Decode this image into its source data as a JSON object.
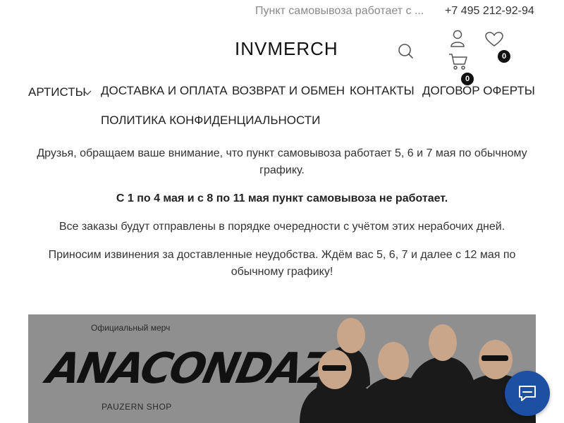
{
  "topbar": {
    "pickup_notice": "Пункт самовывоза работает с ...",
    "phone": "+7 495 212-92-94"
  },
  "header": {
    "logo": "INVMERCH",
    "wishlist_count": "0",
    "cart_count": "0",
    "icons": [
      "search-icon",
      "user-icon",
      "heart-icon",
      "cart-icon"
    ]
  },
  "nav": {
    "items": [
      {
        "label": "АРТИСТЫ",
        "has_dropdown": true
      },
      {
        "label": "ДОСТАВКА И ОПЛАТА"
      },
      {
        "label": "ВОЗВРАТ И ОБМЕН"
      },
      {
        "label": "КОНТАКТЫ"
      },
      {
        "label": "ДОГОВОР ОФЕРТЫ"
      },
      {
        "label": "ПОЛИТИКА КОНФИДЕНЦИАЛЬНОСТИ"
      }
    ]
  },
  "notice": {
    "p1": "Друзья, обращаем ваше внимание, что пункт самовывоза работает 5, 6 и 7 мая по обычному графику.",
    "p2": "С 1 по 4 мая и с 8 по 11 мая пункт самовывоза не работает.",
    "p3": "Все заказы будут отправлены в порядке очередности с учётом этих нерабочих дней.",
    "p4": "Приносим извинения за доставленные неудобства. Ждём вас 5, 6, 7 и далее с 12 мая по обычному графику!"
  },
  "banner": {
    "official": "Официальный мерч",
    "brand": "ANACONDAZ",
    "shop": "PAUZERN SHOP"
  },
  "colors": {
    "chat_button": "#1d4fa3",
    "banner_bg": "#8f8f8f",
    "text": "#222222",
    "muted": "#8a8a8a"
  }
}
